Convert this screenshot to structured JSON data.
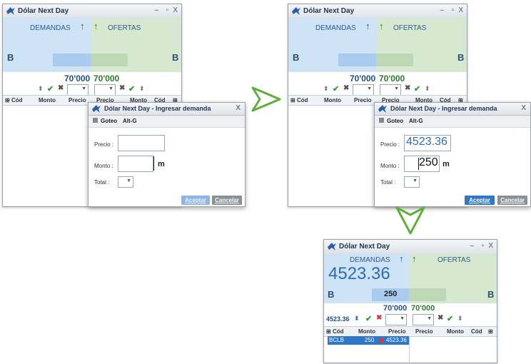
{
  "app_title": "Dólar Next Day",
  "window_controls": {
    "minimize": "–",
    "maximize": "▫",
    "close": "X"
  },
  "panels": {
    "demandas": "DEMANDAS",
    "ofertas": "OFERTAS",
    "side_letter": "B"
  },
  "quantities": {
    "bid": "70'000",
    "ask": "70'000"
  },
  "columns": {
    "left": [
      "Cód",
      "Monto",
      "Precio"
    ],
    "right": [
      "Precio",
      "Monto",
      "Cód"
    ]
  },
  "dialog": {
    "title": "Dólar Next Day - Ingresar demanda",
    "close": "X",
    "goteo_label": "Goteo",
    "goteo_value": "Alt-G",
    "precio_label": "Precio :",
    "monto_label": "Monto :",
    "total_label": "Total :",
    "unit": "m",
    "accept": "Aceptar",
    "cancel": "Cancelar"
  },
  "step2": {
    "precio_value": "4523.36",
    "monto_value": "250"
  },
  "step3": {
    "big_price": "4523.36",
    "bar_qty": "250",
    "price_control": "4523.36",
    "row": {
      "cod": "BCLB",
      "monto": "250",
      "precio": "4523.36"
    }
  },
  "colors": {
    "accent_arrow": "#5fae3e",
    "accept_blue": "#2f77c9",
    "cancel_gray": "#8a9097"
  }
}
